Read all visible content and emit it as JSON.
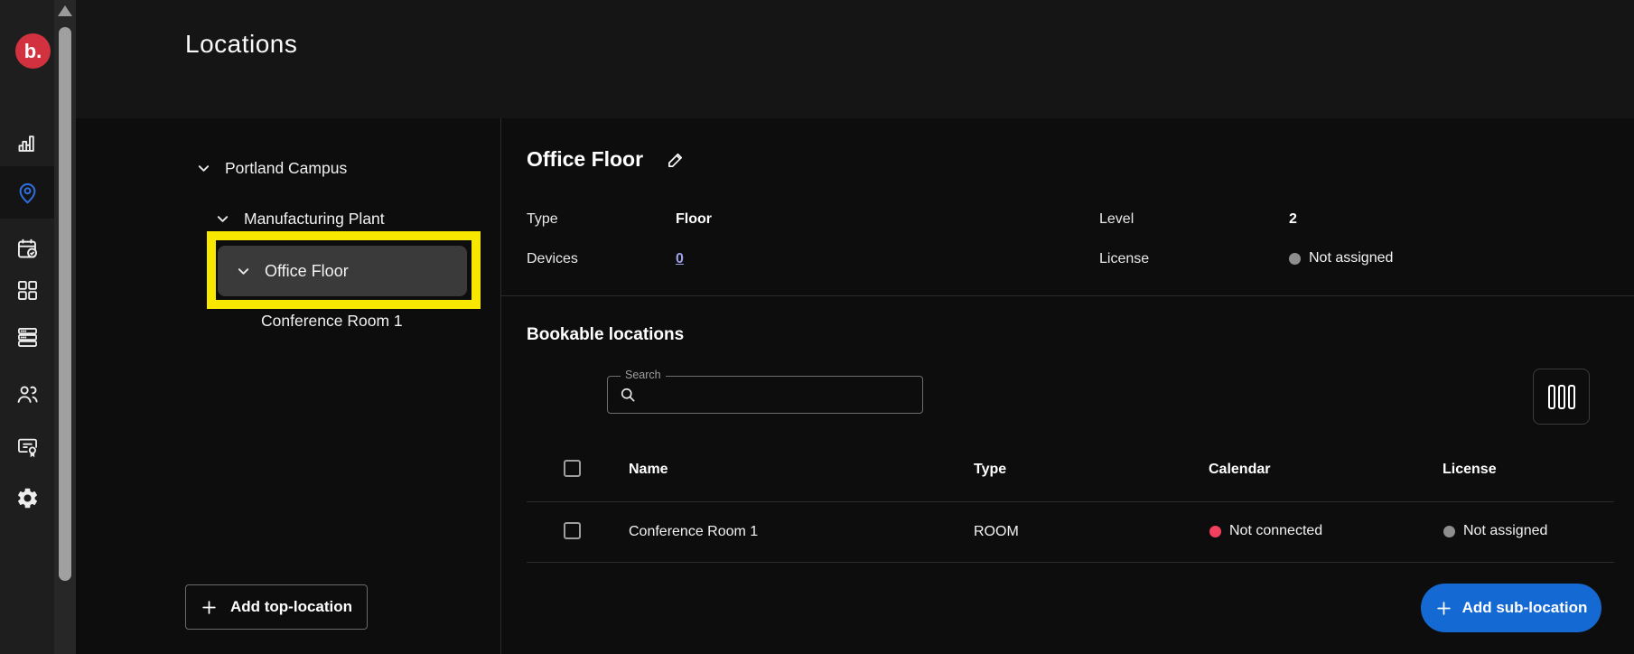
{
  "header": {
    "title": "Locations"
  },
  "sidebar": {
    "logo_text": "b.",
    "items": [
      {
        "name": "analytics",
        "active": false
      },
      {
        "name": "locations",
        "active": true
      },
      {
        "name": "bookings",
        "active": false
      },
      {
        "name": "apps",
        "active": false
      },
      {
        "name": "devices",
        "active": false
      },
      {
        "name": "users",
        "active": false
      },
      {
        "name": "licenses",
        "active": false
      },
      {
        "name": "settings",
        "active": false
      }
    ]
  },
  "tree": {
    "items": [
      {
        "label": "Portland Campus",
        "level": 0,
        "expanded": true,
        "selected": false
      },
      {
        "label": "Manufacturing Plant",
        "level": 1,
        "expanded": true,
        "selected": false
      },
      {
        "label": "Office Floor",
        "level": 2,
        "expanded": true,
        "selected": true,
        "highlighted": true
      },
      {
        "label": "Conference Room 1",
        "level": 3,
        "expanded": false,
        "selected": false
      }
    ],
    "add_button_label": "Add top-location"
  },
  "annotation": {
    "type": "highlight-box",
    "target": "Office Floor",
    "color": "#f8e800"
  },
  "details": {
    "title": "Office Floor",
    "fields": [
      {
        "label": "Type",
        "value": "Floor"
      },
      {
        "label": "Devices",
        "value": "0",
        "is_link": true
      },
      {
        "label": "Level",
        "value": "2"
      },
      {
        "label": "License",
        "value": "Not assigned",
        "status_color": "#8e8e8e"
      }
    ]
  },
  "bookable": {
    "heading": "Bookable locations",
    "search_label": "Search",
    "search_value": "",
    "table": {
      "columns": [
        "Name",
        "Type",
        "Calendar",
        "License"
      ],
      "rows": [
        {
          "name": "Conference Room 1",
          "type": "ROOM",
          "calendar_status": "Not connected",
          "calendar_color": "#f43f5e",
          "license_status": "Not assigned",
          "license_color": "#8e8e8e"
        }
      ]
    },
    "add_button_label": "Add sub-location"
  },
  "colors": {
    "accent_blue": "#1569d3",
    "active_icon_blue": "#2e6fe0",
    "logo_red": "#d2323f",
    "highlight_yellow": "#f8e800",
    "link_periwinkle": "#9fa0e8",
    "status_red": "#f43f5e",
    "status_gray": "#8e8e8e",
    "selected_row_bg": "#3a3a3a"
  }
}
